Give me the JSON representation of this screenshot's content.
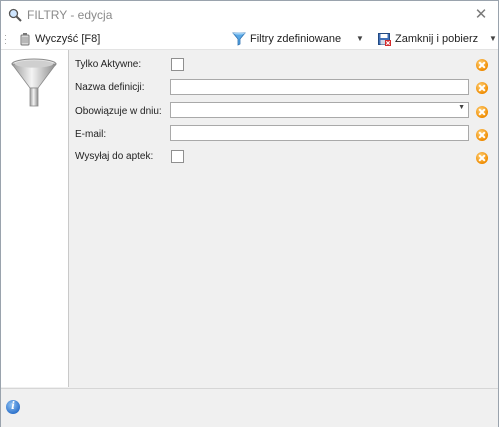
{
  "window": {
    "title": "FILTRY - edycja",
    "icons": {
      "title": "search-icon",
      "close": "close-icon"
    }
  },
  "toolbar": {
    "clear_label": "Wyczyść [F8]",
    "defined_filters_label": "Filtry zdefiniowane",
    "close_fetch_label": "Zamknij i pobierz"
  },
  "form": {
    "only_active": {
      "label": "Tylko Aktywne:",
      "checked": false
    },
    "definition_name": {
      "label": "Nazwa definicji:",
      "value": ""
    },
    "valid_on_day": {
      "label": "Obowiązuje w dniu:",
      "value": ""
    },
    "email": {
      "label": "E-mail:",
      "value": ""
    },
    "send_to_pharmacies": {
      "label": "Wysyłaj do aptek:",
      "checked": false
    }
  },
  "status": {
    "info_icon": "info-icon"
  },
  "colors": {
    "accent_orange": "#f08c00",
    "info_blue": "#2b6fc9",
    "border": "#9aa3ad"
  }
}
